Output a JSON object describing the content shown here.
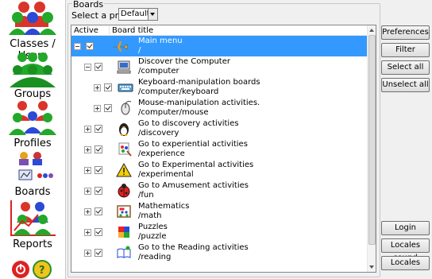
{
  "nav": {
    "items": [
      {
        "label": "Classes / Users",
        "icon": "classes-users-icon"
      },
      {
        "label": "Groups",
        "icon": "groups-icon"
      },
      {
        "label": "Profiles",
        "icon": "profiles-icon"
      },
      {
        "label": "Boards",
        "icon": "boards-icon"
      },
      {
        "label": "Reports",
        "icon": "reports-icon"
      }
    ]
  },
  "boards": {
    "legend": "Boards",
    "profile_label": "Select a profile:",
    "profile_value": "Default",
    "col_active": "Active",
    "col_title": "Board title",
    "rows": [
      {
        "title": "Main menu",
        "path": "/",
        "icon": "airplane-icon",
        "selected": true,
        "expanded": true,
        "level": 0
      },
      {
        "title": "Discover the Computer",
        "path": "/computer",
        "icon": "computer-icon",
        "selected": false,
        "expanded": true,
        "level": 1
      },
      {
        "title": "Keyboard-manipulation boards",
        "path": "/computer/keyboard",
        "icon": "keyboard-icon",
        "selected": false,
        "expanded": false,
        "level": 2
      },
      {
        "title": "Mouse-manipulation activities.",
        "path": "/computer/mouse",
        "icon": "mouse-icon",
        "selected": false,
        "expanded": false,
        "level": 2
      },
      {
        "title": "Go to discovery activities",
        "path": "/discovery",
        "icon": "penguin-icon",
        "selected": false,
        "expanded": false,
        "level": 1
      },
      {
        "title": "Go to experiential activities",
        "path": "/experience",
        "icon": "paint-icon",
        "selected": false,
        "expanded": false,
        "level": 1
      },
      {
        "title": "Go to Experimental activities",
        "path": "/experimental",
        "icon": "warning-icon",
        "selected": false,
        "expanded": false,
        "level": 1
      },
      {
        "title": "Go to Amusement activities",
        "path": "/fun",
        "icon": "ladybug-icon",
        "selected": false,
        "expanded": false,
        "level": 1
      },
      {
        "title": "Mathematics",
        "path": "/math",
        "icon": "abacus-icon",
        "selected": false,
        "expanded": false,
        "level": 1
      },
      {
        "title": "Puzzles",
        "path": "/puzzle",
        "icon": "puzzle-icon",
        "selected": false,
        "expanded": false,
        "level": 1
      },
      {
        "title": "Go to the Reading activities",
        "path": "/reading",
        "icon": "reading-icon",
        "selected": false,
        "expanded": false,
        "level": 1
      }
    ]
  },
  "buttons": {
    "preferences": "Preferences",
    "filter": "Filter",
    "select_all": "Select all",
    "unselect_all": "Unselect all",
    "login": "Login",
    "locales_sound": "Locales sound",
    "locales": "Locales"
  },
  "colors": {
    "selection": "#3399ff",
    "nav_people_red": "#d02020",
    "nav_people_green": "#22a82a",
    "nav_people_blue": "#2b4ad6"
  }
}
